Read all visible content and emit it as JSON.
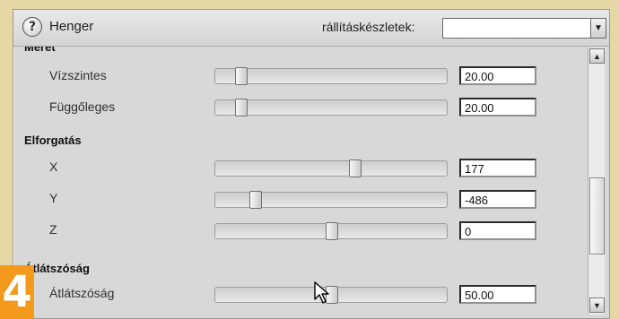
{
  "header": {
    "help_icon": "?",
    "title": "Henger",
    "preset_label": "rállításkészletek:",
    "preset_value": "",
    "dropdown_icon": "chevron-down-icon"
  },
  "sections": [
    {
      "title": "Méret",
      "rows": [
        {
          "label": "Vízszintes",
          "value": "20.00",
          "slider_fraction": 0.11
        },
        {
          "label": "Függőleges",
          "value": "20.00",
          "slider_fraction": 0.11
        }
      ]
    },
    {
      "title": "Elforgatás",
      "rows": [
        {
          "label": "X",
          "value": "177",
          "slider_fraction": 0.6
        },
        {
          "label": "Y",
          "value": "-486",
          "slider_fraction": 0.17
        },
        {
          "label": "Z",
          "value": "0",
          "slider_fraction": 0.5
        }
      ]
    },
    {
      "title": "Átlátszóság",
      "rows": [
        {
          "label": "Átlátszóság",
          "value": "50.00",
          "slider_fraction": 0.5
        }
      ]
    }
  ],
  "step_number": "4",
  "colors": {
    "accent": "#f39a1c",
    "panel": "#d8d8d8",
    "background": "#e6d7a6"
  }
}
